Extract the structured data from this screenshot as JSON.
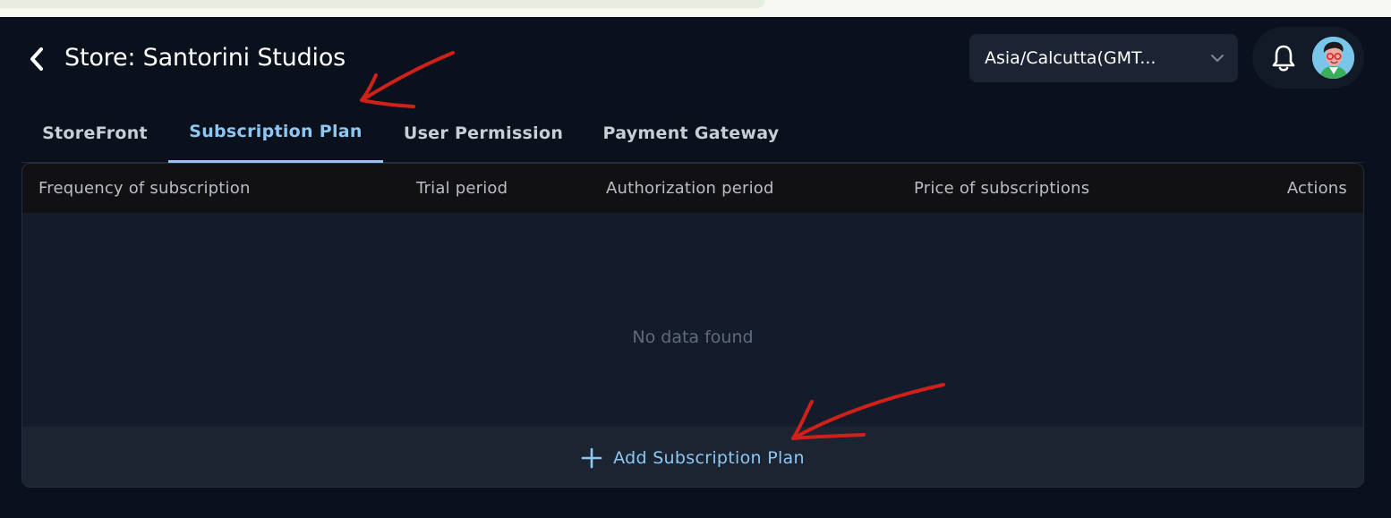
{
  "header": {
    "title": "Store: Santorini Studios",
    "back_icon": "chevron-left-icon",
    "timezone": {
      "value": "Asia/Calcutta(GMT..."
    },
    "notification_icon": "bell-icon",
    "avatar_icon": "user-avatar"
  },
  "tabs": [
    {
      "label": "StoreFront",
      "active": false
    },
    {
      "label": "Subscription Plan",
      "active": true
    },
    {
      "label": "User Permission",
      "active": false
    },
    {
      "label": "Payment Gateway",
      "active": false
    }
  ],
  "table": {
    "columns": [
      "Frequency of subscription",
      "Trial period",
      "Authorization period",
      "Price of subscriptions",
      "Actions"
    ],
    "rows": [],
    "empty_message": "No data found"
  },
  "footer": {
    "add_label": "Add Subscription Plan",
    "add_icon": "plus-icon"
  },
  "colors": {
    "background": "#0b111c",
    "accent": "#8cc8f3",
    "annotation": "#d0201a"
  }
}
